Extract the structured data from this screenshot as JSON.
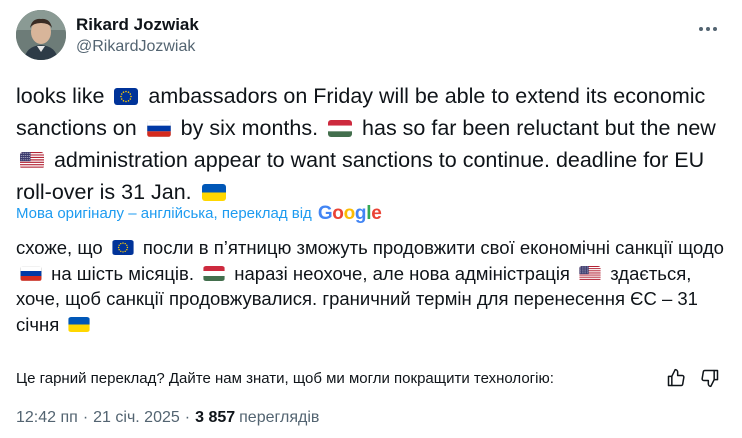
{
  "author": {
    "display_name": "Rikard Jozwiak",
    "handle": "@RikardJozwiak"
  },
  "tweet": {
    "segments": [
      {
        "text": "looks like "
      },
      {
        "flag": "eu"
      },
      {
        "text": " ambassadors on Friday will be able to extend its economic sanctions on "
      },
      {
        "flag": "ru"
      },
      {
        "text": " by six months. "
      },
      {
        "flag": "hu"
      },
      {
        "text": " has so far been reluctant but the new "
      },
      {
        "flag": "us"
      },
      {
        "text": " administration appear to want sanctions to continue. deadline for EU roll-over is 31 Jan. "
      },
      {
        "flag": "ua"
      }
    ]
  },
  "translation": {
    "source_label": "Мова оригіналу – англійська, переклад від",
    "provider": "Google",
    "segments": [
      {
        "text": "схоже, що "
      },
      {
        "flag": "eu"
      },
      {
        "text": " посли в п’ятницю зможуть продовжити свої економічні санкції щодо "
      },
      {
        "flag": "ru"
      },
      {
        "text": " на шість місяців. "
      },
      {
        "flag": "hu"
      },
      {
        "text": " наразі неохоче, але нова адміністрація "
      },
      {
        "flag": "us"
      },
      {
        "text": " здається, хоче, щоб санкції продовжувалися. граничний термін для перенесення ЄС – 31 січня "
      },
      {
        "flag": "ua"
      }
    ],
    "feedback_prompt": "Це гарний переклад? Дайте нам знати, щоб ми могли покращити технологію:"
  },
  "meta": {
    "time": "12:42 пп",
    "date": "21 січ. 2025",
    "views_count": "3 857",
    "views_label": "переглядів"
  },
  "icons": {
    "more": "more-horizontal-icon",
    "thumbs_up": "thumbs-up-icon",
    "thumbs_down": "thumbs-down-icon",
    "flags": [
      "eu-flag-icon",
      "russia-flag-icon",
      "hungary-flag-icon",
      "us-flag-icon",
      "ukraine-flag-icon"
    ]
  },
  "colors": {
    "text": "#0f1419",
    "secondary": "#536471",
    "link": "#1d9bf0"
  }
}
